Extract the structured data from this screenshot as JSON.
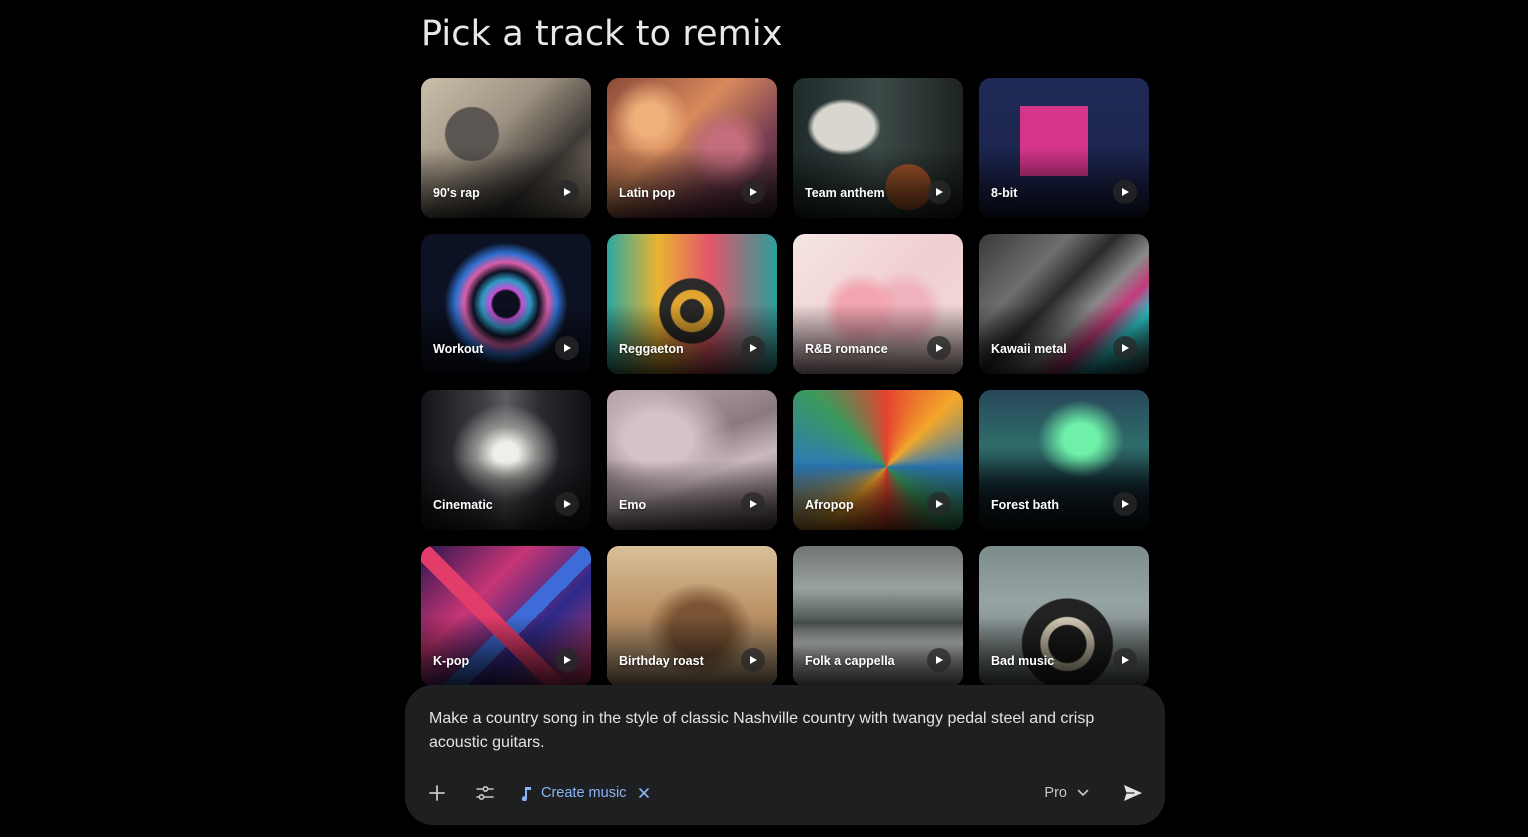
{
  "page_title": "Pick a track to remix",
  "tracks": [
    {
      "label": "90's rap",
      "art": "a-90s"
    },
    {
      "label": "Latin pop",
      "art": "a-latin"
    },
    {
      "label": "Team anthem",
      "art": "a-team"
    },
    {
      "label": "8-bit",
      "art": "a-8bit"
    },
    {
      "label": "Workout",
      "art": "a-workout"
    },
    {
      "label": "Reggaeton",
      "art": "a-reggaeton"
    },
    {
      "label": "R&B romance",
      "art": "a-rnb"
    },
    {
      "label": "Kawaii metal",
      "art": "a-kawaii"
    },
    {
      "label": "Cinematic",
      "art": "a-cinematic"
    },
    {
      "label": "Emo",
      "art": "a-emo"
    },
    {
      "label": "Afropop",
      "art": "a-afropop"
    },
    {
      "label": "Forest bath",
      "art": "a-forest"
    },
    {
      "label": "K-pop",
      "art": "a-kpop"
    },
    {
      "label": "Birthday roast",
      "art": "a-birthday"
    },
    {
      "label": "Folk a cappella",
      "art": "a-folk"
    },
    {
      "label": "Bad music",
      "art": "a-bad"
    }
  ],
  "composer": {
    "prompt": "Make a country song in the style of classic Nashville country with twangy pedal steel and crisp acoustic guitars.",
    "add_icon": "plus-icon",
    "tools_icon": "sliders-icon",
    "chip_label": "Create music",
    "chip_icon": "music-note-icon",
    "chip_close_icon": "close-icon",
    "mode_label": "Pro",
    "mode_icon": "chevron-down-icon",
    "send_icon": "send-icon"
  },
  "colors": {
    "background": "#000000",
    "composer_bg": "#1e1f20",
    "chip_accent": "#8ab4f8",
    "text": "#e3e3e3"
  }
}
